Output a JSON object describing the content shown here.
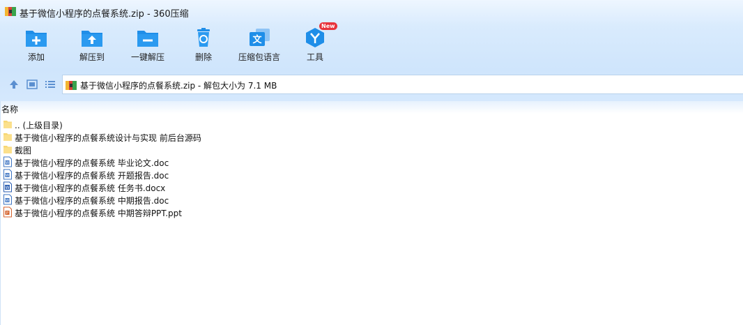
{
  "window": {
    "title": "基于微信小程序的点餐系统.zip - 360压缩"
  },
  "toolbar": {
    "add_label": "添加",
    "extract_label": "解压到",
    "oneclick_label": "一键解压",
    "delete_label": "删除",
    "language_label": "压缩包语言",
    "tools_label": "工具",
    "tools_badge": "New"
  },
  "address": {
    "text": "基于微信小程序的点餐系统.zip - 解包大小为 7.1 MB"
  },
  "list": {
    "column_name": "名称",
    "items": [
      {
        "name": ".. (上级目录)",
        "type": "folder"
      },
      {
        "name": "基于微信小程序的点餐系统设计与实现 前后台源码",
        "type": "folder"
      },
      {
        "name": "截图",
        "type": "folder"
      },
      {
        "name": "基于微信小程序的点餐系统 毕业论文.doc",
        "type": "doc"
      },
      {
        "name": "基于微信小程序的点餐系统 开题报告.doc",
        "type": "doc"
      },
      {
        "name": "基于微信小程序的点餐系统 任务书.docx",
        "type": "docx"
      },
      {
        "name": "基于微信小程序的点餐系统 中期报告.doc",
        "type": "doc"
      },
      {
        "name": "基于微信小程序的点餐系统 中期答辩PPT.ppt",
        "type": "ppt"
      }
    ]
  },
  "colors": {
    "accent": "#1e8ee8",
    "folder": "#f7d774",
    "badge": "#e8333b"
  }
}
